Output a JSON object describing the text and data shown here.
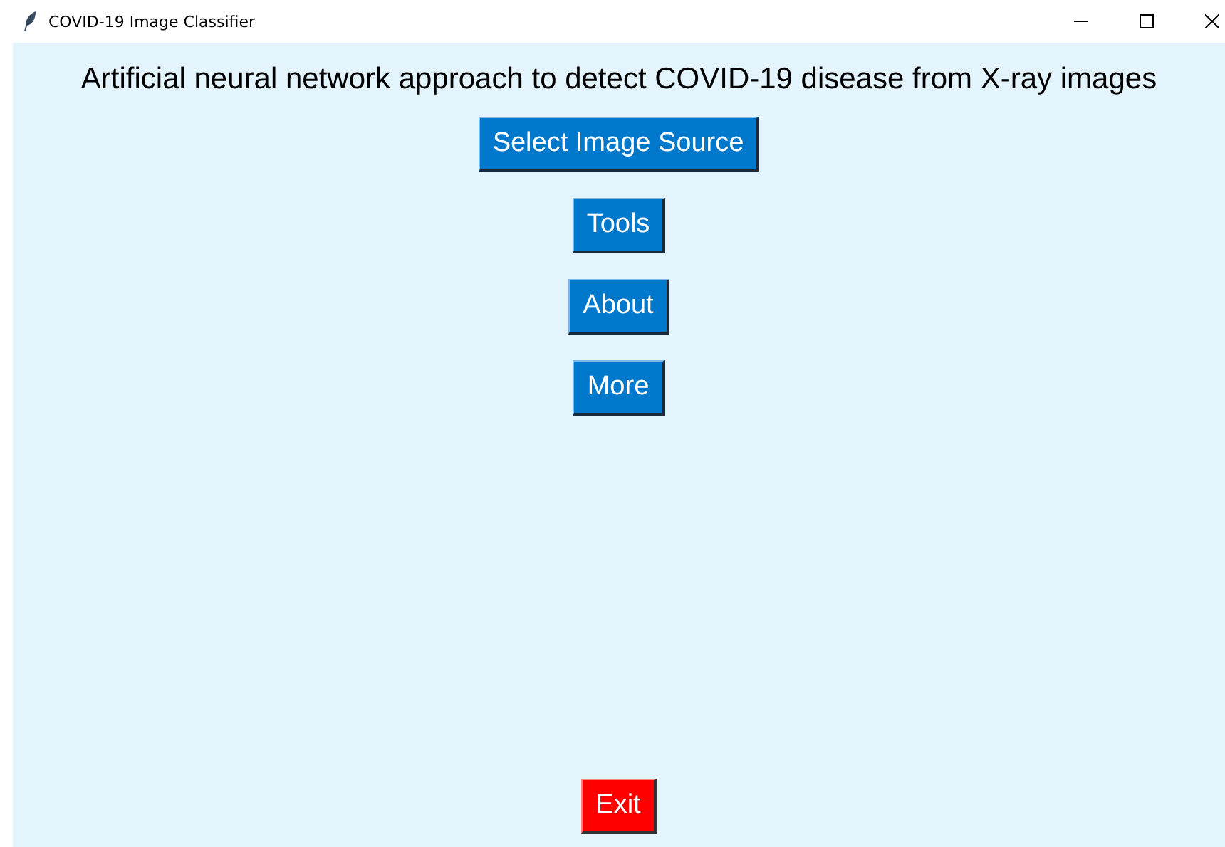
{
  "window": {
    "title": "COVID-19 Image Classifier"
  },
  "heading": "Artificial neural network approach to detect COVID-19 disease from X-ray images",
  "menu_buttons": [
    "Select Image Source",
    "Tools",
    "About",
    "More"
  ],
  "exit_button": "Exit"
}
